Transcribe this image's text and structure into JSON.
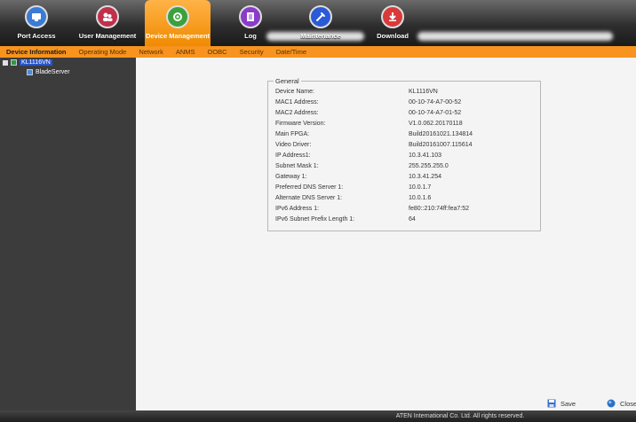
{
  "toolbar": {
    "items": [
      {
        "label": "Port Access",
        "icon": "port-access-icon",
        "color": "#3a7bd5"
      },
      {
        "label": "User Management",
        "icon": "user-management-icon",
        "color": "#c0304a"
      },
      {
        "label": "Device Management",
        "icon": "device-management-icon",
        "color": "#3ca03c"
      },
      {
        "label": "Log",
        "icon": "log-icon",
        "color": "#8a3cc8"
      },
      {
        "label": "Maintenance",
        "icon": "maintenance-icon",
        "color": "#2a5ad8"
      },
      {
        "label": "Download",
        "icon": "download-icon",
        "color": "#d83a3a"
      }
    ],
    "active_index": 2
  },
  "submenu": {
    "items": [
      "Device Information",
      "Operating Mode",
      "Network",
      "ANMS",
      "OOBC",
      "Security",
      "Date/Time"
    ],
    "active_index": 0
  },
  "tree": {
    "root": "KL1116VN",
    "child": "BladeServer"
  },
  "general": {
    "legend": "General",
    "rows": [
      {
        "label": "Device Name:",
        "value": "KL1116VN"
      },
      {
        "label": "MAC1 Address:",
        "value": "00-10-74-A7-00-52"
      },
      {
        "label": "MAC2 Address:",
        "value": "00-10-74-A7-01-52"
      },
      {
        "label": "Firmware Version:",
        "value": "V1.0.062.20170118"
      },
      {
        "label": "Main FPGA:",
        "value": "Build20161021.134814"
      },
      {
        "label": "Video Driver:",
        "value": "Build20161007.115614"
      },
      {
        "label": "IP Address1:",
        "value": "10.3.41.103"
      },
      {
        "label": "Subnet Mask 1:",
        "value": "255.255.255.0"
      },
      {
        "label": "Gateway 1:",
        "value": "10.3.41.254"
      },
      {
        "label": "Preferred DNS Server 1:",
        "value": "10.0.1.7"
      },
      {
        "label": "Alternate DNS Server 1:",
        "value": "10.0.1.6"
      },
      {
        "label": "IPv6 Address 1:",
        "value": "fe80::210:74ff:fea7:52"
      },
      {
        "label": "IPv6 Subnet Prefix Length 1:",
        "value": "64"
      }
    ]
  },
  "buttons": {
    "save": "Save",
    "close": "Close"
  },
  "footer": {
    "text": "ATEN International Co. Ltd. All rights reserved."
  }
}
